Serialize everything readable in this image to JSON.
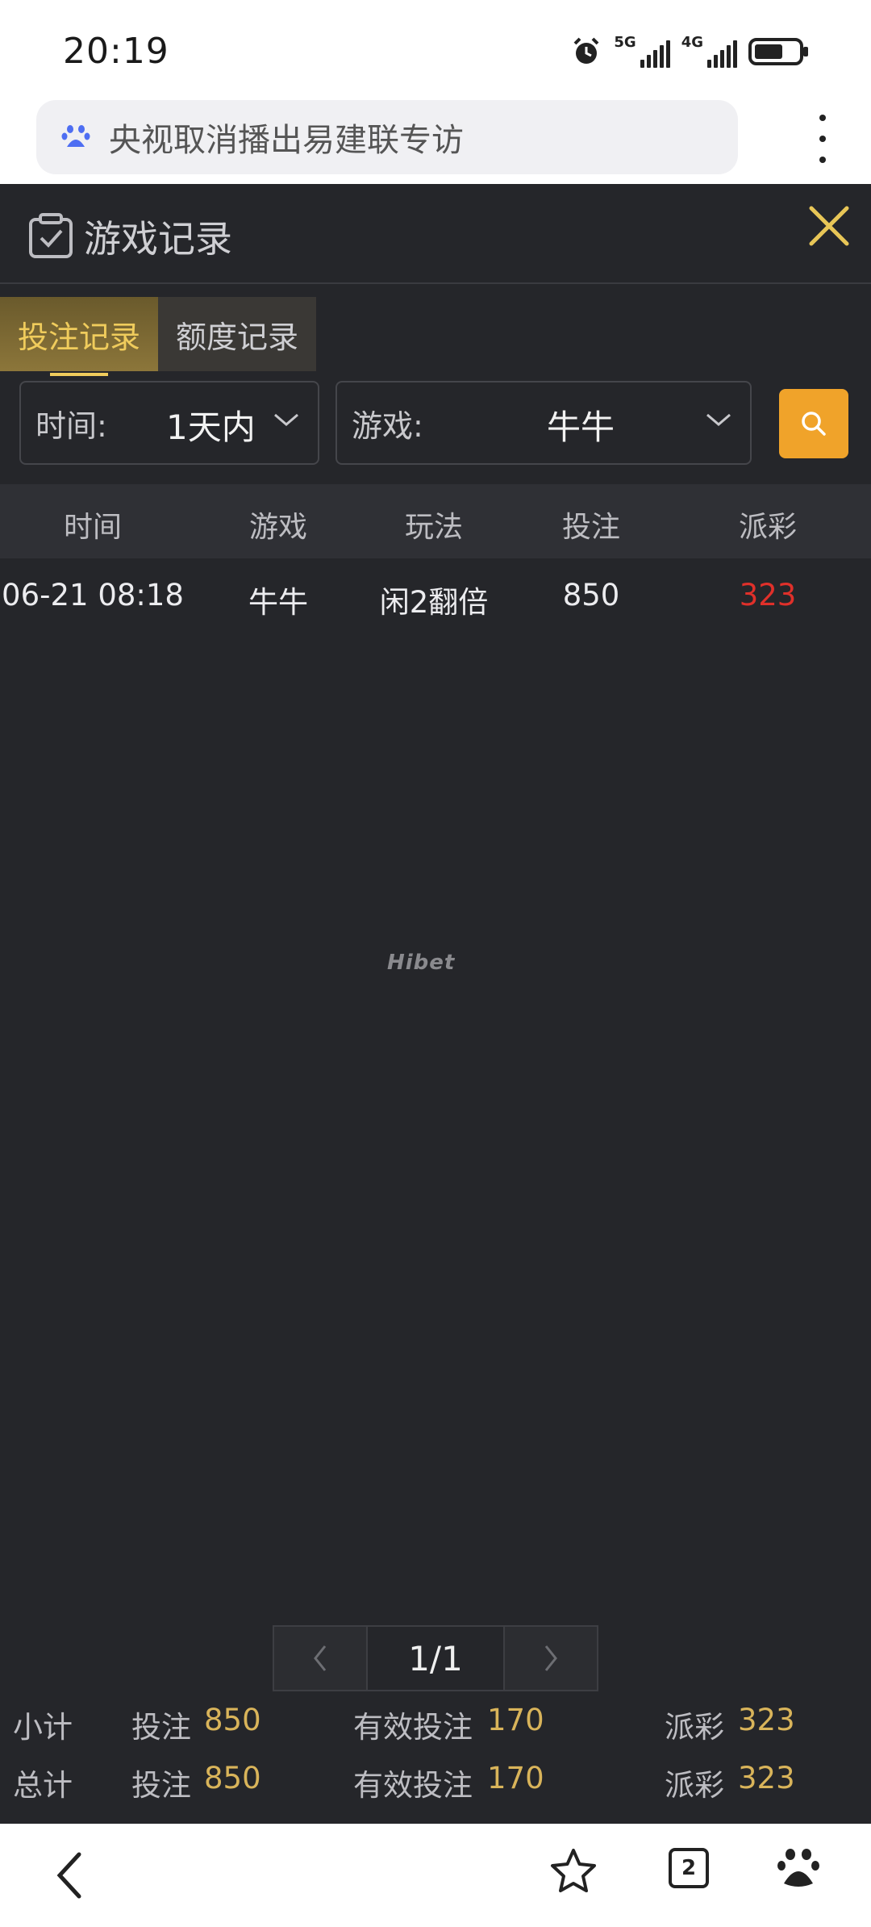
{
  "status_bar": {
    "time": "20:19",
    "network_1": "5G",
    "network_2": "4G"
  },
  "address_bar": {
    "text": "央视取消播出易建联专访",
    "icon": "baidu-paw-icon"
  },
  "panel": {
    "title": "游戏记录",
    "tabs": [
      {
        "label": "投注记录",
        "active": true
      },
      {
        "label": "额度记录",
        "active": false
      }
    ],
    "filters": {
      "time_label": "时间:",
      "time_value": "1天内",
      "game_label": "游戏:",
      "game_value": "牛牛"
    },
    "table": {
      "headers": [
        "时间",
        "游戏",
        "玩法",
        "投注",
        "派彩"
      ],
      "rows": [
        {
          "time": "06-21 08:18",
          "game": "牛牛",
          "play": "闲2翻倍",
          "bet": "850",
          "payout": "323"
        }
      ]
    },
    "watermark": "Hibet",
    "pager": {
      "current": "1/1"
    },
    "summary": {
      "subtotal": {
        "label": "小计",
        "bet_label": "投注",
        "bet": "850",
        "valid_label": "有效投注",
        "valid": "170",
        "payout_label": "派彩",
        "payout": "323"
      },
      "total": {
        "label": "总计",
        "bet_label": "投注",
        "bet": "850",
        "valid_label": "有效投注",
        "valid": "170",
        "payout_label": "派彩",
        "payout": "323"
      }
    }
  },
  "bottom_nav": {
    "tab_count": "2"
  },
  "colors": {
    "panel_bg": "#25262a",
    "accent_gold": "#f0cc5c",
    "search_orange": "#f0a32a",
    "payout_red": "#e0302a",
    "summary_value": "#d9b45a"
  }
}
